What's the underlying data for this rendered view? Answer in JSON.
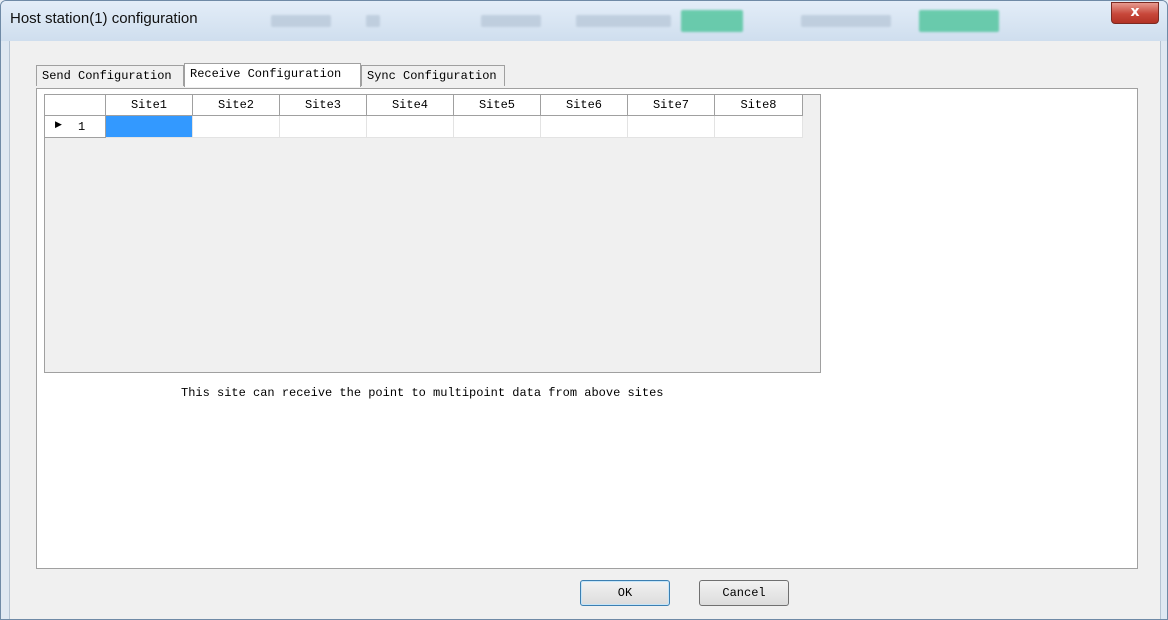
{
  "window": {
    "title": "Host station(1) configuration",
    "close_label": "x"
  },
  "tabs": [
    "Send Configuration",
    "Receive Configuration",
    "Sync Configuration"
  ],
  "active_tab": "Receive Configuration",
  "grid": {
    "columns": [
      "Site1",
      "Site2",
      "Site3",
      "Site4",
      "Site5",
      "Site6",
      "Site7",
      "Site8"
    ],
    "rows": [
      {
        "label": "1",
        "cells": [
          "",
          "",
          "",
          "",
          "",
          "",
          "",
          ""
        ]
      }
    ],
    "selected_cell": "Site1"
  },
  "info_text": "This site can receive the point to multipoint data from above sites",
  "buttons": {
    "ok": "OK",
    "cancel": "Cancel"
  },
  "colors": {
    "selection": "#3399ff",
    "close_button": "#c7473a"
  }
}
